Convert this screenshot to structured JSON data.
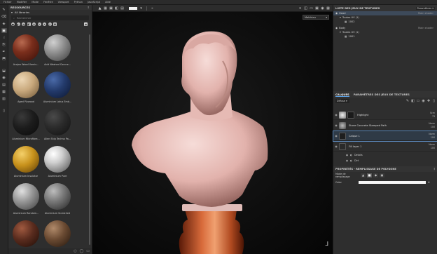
{
  "menu": [
    "Fichier",
    "Modifier",
    "Mode",
    "Fenêtre",
    "Viewport",
    "Python",
    "JavaScript",
    "Aide"
  ],
  "resources": {
    "title": "RESSOURCES",
    "section": "All libraries",
    "search_placeholder": "Rechercher",
    "materials": [
      {
        "label": "Acajou Wood Varnis...",
        "color": "#7a2e1c"
      },
      {
        "label": "Acid Washed Concre...",
        "color": "#8a8a8a"
      },
      {
        "label": "Aged Plywood",
        "color": "#c8a87c"
      },
      {
        "label": "Aluminium Lotus Emb...",
        "color": "#233a6b"
      },
      {
        "label": "Aluminium Microfibre...",
        "color": "#1c1c1c"
      },
      {
        "label": "Alien Ship Techno Pa...",
        "color": "#2a2a2a"
      },
      {
        "label": "Aluminium Insulator",
        "color": "#c8921c"
      },
      {
        "label": "Aluminium Pure",
        "color": "#cfcfcf"
      },
      {
        "label": "Aluminium Random...",
        "color": "#9a9a9a"
      },
      {
        "label": "Aluminium Scratched",
        "color": "#7a7a7a"
      },
      {
        "label": "Aniline Horse Leather",
        "color": "#5a2c1e"
      },
      {
        "label": "Antique Bronze Dark...",
        "color": "#6a4a32"
      }
    ]
  },
  "viewport": {
    "mode_select": "Matériau",
    "swatch_color": "#f0f0f0"
  },
  "texture_sets": {
    "title": "LISTE DES JEUX DE TEXTURES",
    "settings_label": "Paramètres",
    "rows": [
      {
        "label": "Head",
        "right": "Main shader",
        "selected": true,
        "indent": 0
      },
      {
        "label": "Toutes UV (1)",
        "right": "",
        "selected": false,
        "indent": 1
      },
      {
        "label": "1002",
        "right": "",
        "selected": false,
        "indent": 2
      },
      {
        "label": "Body",
        "right": "Main shader",
        "selected": false,
        "indent": 0
      },
      {
        "label": "Toutes UV (1)",
        "right": "",
        "selected": false,
        "indent": 1
      },
      {
        "label": "1001",
        "right": "",
        "selected": false,
        "indent": 2
      }
    ]
  },
  "layers": {
    "tab_layers": "CALQUES",
    "tab_params": "PARAMÈTRES DES JEUX DE TEXTURES",
    "channel": "Diffuse",
    "items": [
      {
        "name": "Highlight",
        "blend": "Scrn",
        "opacity": "73",
        "thumb": "#d8d8d8",
        "selected": false
      },
      {
        "name": "Stone Concrete Stamped Path",
        "blend": "Norm",
        "opacity": "100",
        "thumb": "#8a8a8a",
        "selected": false
      },
      {
        "name": "Calque 1",
        "blend": "Norm",
        "opacity": "100",
        "thumb": "#1e1e1e",
        "selected": true
      },
      {
        "name": "Fill layer 1",
        "blend": "Norm",
        "opacity": "100",
        "thumb": "#2a2a2a",
        "selected": false
      }
    ],
    "sub_items": [
      "Details",
      "Dirt"
    ]
  },
  "properties": {
    "title": "PROPRIÉTÉS - REMPLISSAGE DE POLYGONE",
    "mode_label": "Mode de remplissage",
    "color_label": "Color",
    "color_value": "#f5f5f5"
  }
}
